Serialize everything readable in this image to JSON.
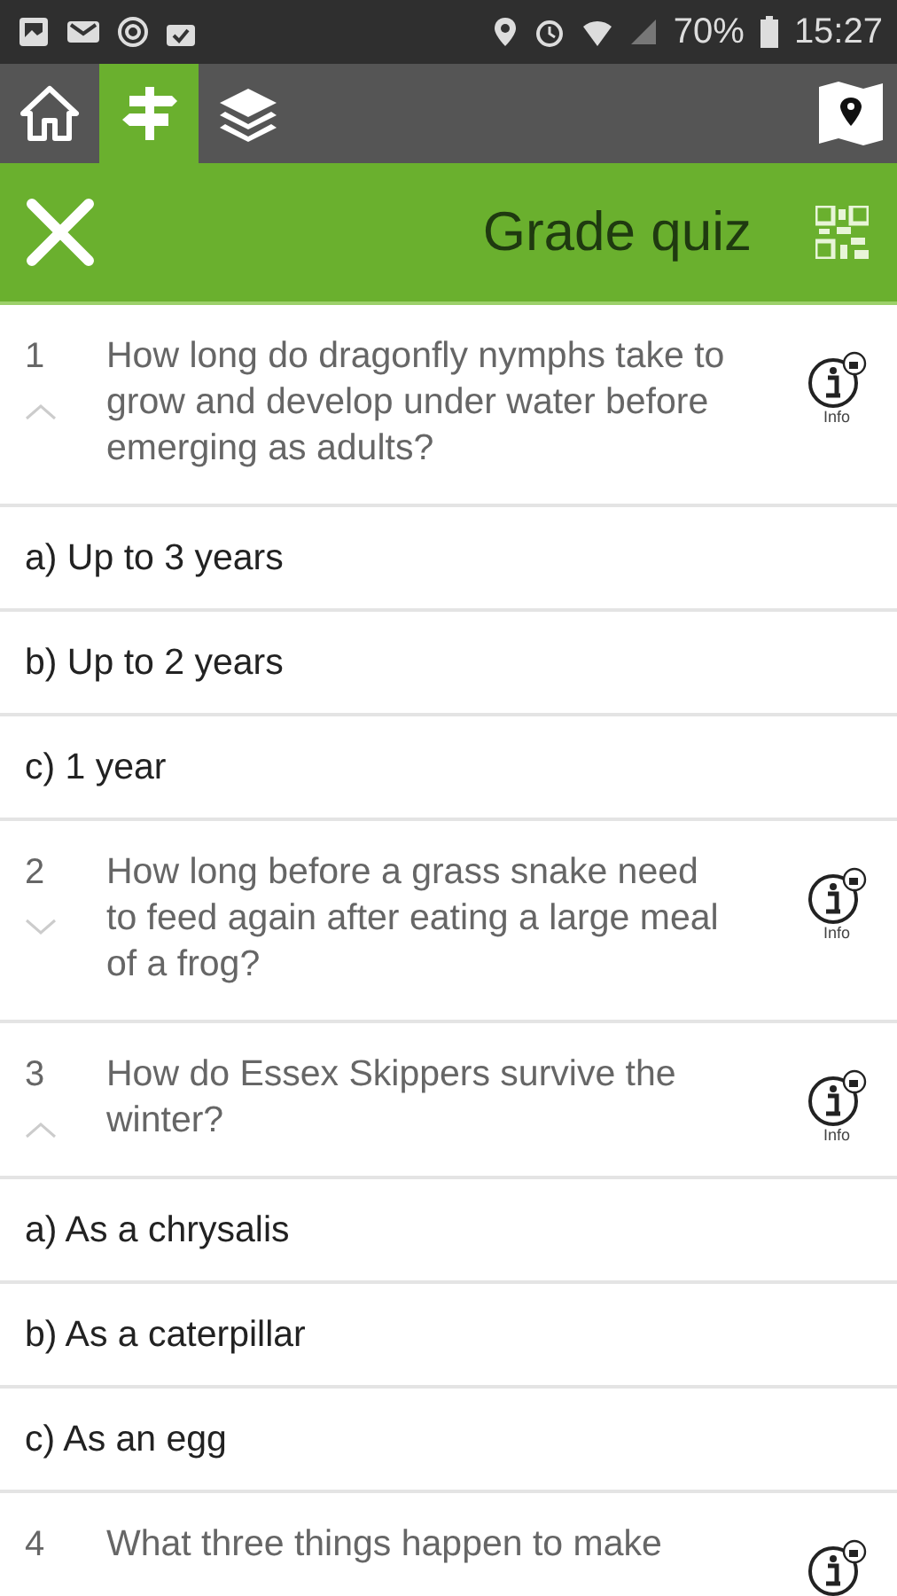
{
  "status_bar": {
    "battery": "70%",
    "time": "15:27"
  },
  "tabs": [
    {
      "kind": "home",
      "selected": false
    },
    {
      "kind": "signpost",
      "selected": true
    },
    {
      "kind": "layers",
      "selected": false
    }
  ],
  "header": {
    "title": "Grade quiz"
  },
  "questions": [
    {
      "number": "1",
      "text": "How long do dragonfly nymphs take to grow and develop under water before emerging as adults?",
      "expanded": true,
      "info": "Info",
      "answers": [
        "a) Up to 3 years",
        "b) Up to 2 years",
        "c) 1 year"
      ]
    },
    {
      "number": "2",
      "text": "How long before a grass snake need to feed again after eating a large meal of a frog?",
      "expanded": false,
      "info": "Info"
    },
    {
      "number": "3",
      "text": "How do Essex Skippers survive the winter?",
      "expanded": true,
      "info": "Info",
      "answers": [
        "a) As a chrysalis",
        "b) As a caterpillar",
        "c) As an egg"
      ]
    },
    {
      "number": "4",
      "text": "What three things happen to make"
    }
  ]
}
